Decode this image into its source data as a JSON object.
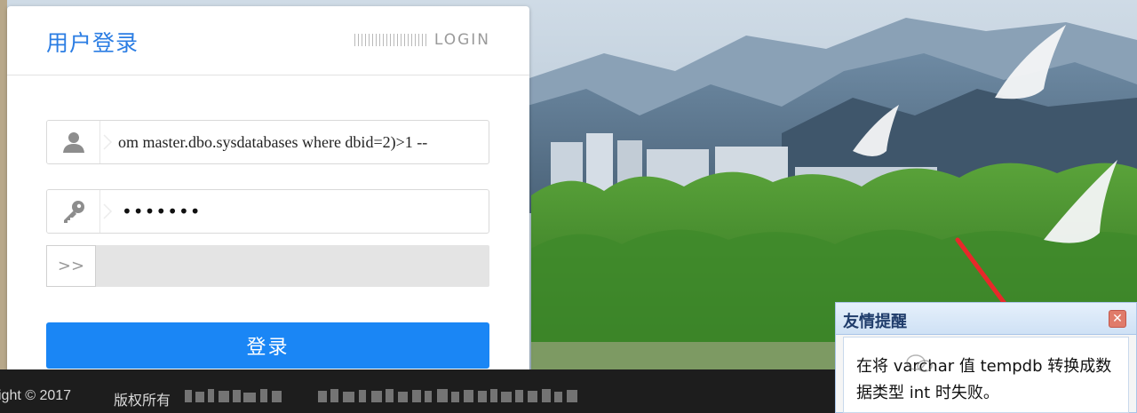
{
  "login_panel": {
    "title": "用户登录",
    "badge": "LOGIN",
    "username_value": "om master.dbo.sysdatabases where dbid=2)>1 --",
    "password_mask": "•••••••",
    "slider_handle": ">>",
    "login_button": "登录"
  },
  "footer": {
    "copyright": "ight © 2017",
    "rights_label": "版权所有"
  },
  "dialog": {
    "title": "友情提醒",
    "close_symbol": "✕",
    "message": "在将 varchar 值 tempdb 转换成数据类型 int 时失败。"
  },
  "colors": {
    "accent": "#1a86f5",
    "title_blue": "#2b7de3",
    "footer_bg": "#1d1d1d",
    "arrow_red": "#e8282a"
  }
}
